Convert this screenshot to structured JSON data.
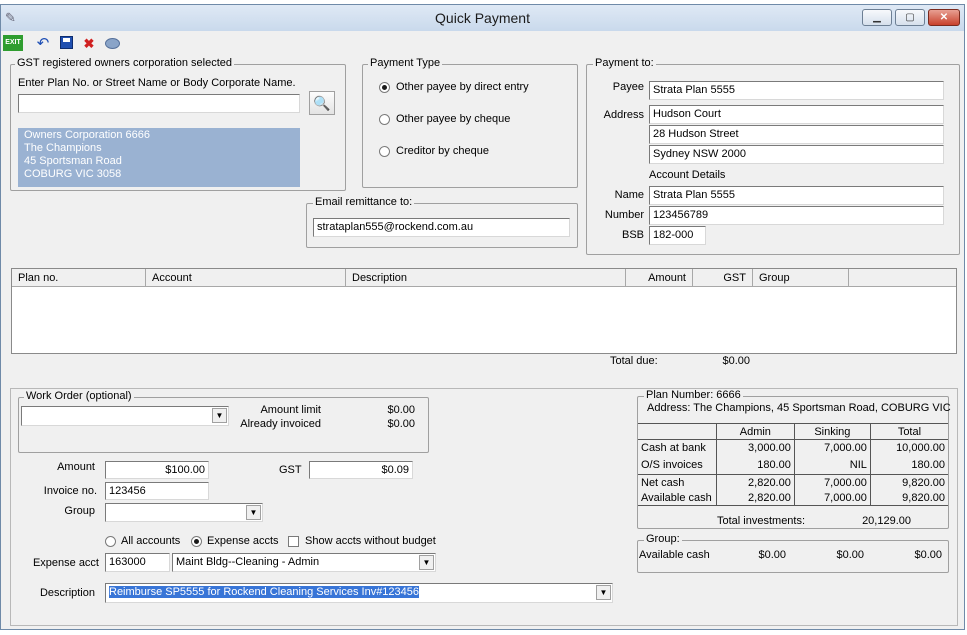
{
  "window": {
    "title": "Quick Payment"
  },
  "toolbar": {
    "buttons": [
      "exit-icon",
      "undo-icon",
      "save-icon",
      "delete-icon",
      "database-icon"
    ],
    "exit_label": "EXIT"
  },
  "gst_group": {
    "legend": "GST registered owners corporation selected",
    "prompt": "Enter Plan No. or Street Name or Body Corporate Name.",
    "search_value": "",
    "selected": [
      "Owners Corporation 6666",
      "The Champions",
      "45 Sportsman Road",
      "COBURG  VIC  3058"
    ]
  },
  "payment_type": {
    "legend": "Payment Type",
    "options": [
      "Other payee by direct entry",
      "Other payee by cheque",
      "Creditor by cheque"
    ],
    "selected_index": 0
  },
  "email": {
    "legend": "Email remittance to:",
    "value": "strataplan555@rockend.com.au"
  },
  "payment_to": {
    "legend": "Payment to:",
    "payee_label": "Payee",
    "payee": "Strata Plan 5555",
    "address_label": "Address",
    "address": [
      "Hudson Court",
      "28 Hudson Street",
      "Sydney NSW 2000"
    ],
    "account_details_label": "Account Details",
    "name_label": "Name",
    "name": "Strata Plan 5555",
    "number_label": "Number",
    "number": "123456789",
    "bsb_label": "BSB",
    "bsb": "182-000"
  },
  "grid": {
    "columns": [
      "Plan no.",
      "Account",
      "Description",
      "Amount",
      "GST",
      "Group"
    ],
    "rows": []
  },
  "total_due": {
    "label": "Total due:",
    "value": "$0.00"
  },
  "work_order": {
    "legend": "Work Order (optional)",
    "value": "",
    "amount_limit_label": "Amount limit",
    "amount_limit": "$0.00",
    "already_invoiced_label": "Already invoiced",
    "already_invoiced": "$0.00"
  },
  "form": {
    "amount_label": "Amount",
    "amount": "$100.00",
    "gst_label": "GST",
    "gst": "$0.09",
    "invoice_label": "Invoice no.",
    "invoice": "123456",
    "group_label": "Group",
    "group": "",
    "account_filters": [
      "All accounts",
      "Expense accts"
    ],
    "account_filter_selected": 1,
    "show_without_budget_label": "Show accts without budget",
    "show_without_budget": false,
    "expense_acct_label": "Expense acct",
    "expense_acct_code": "163000",
    "expense_acct_name": "Maint Bldg--Cleaning - Admin",
    "description_label": "Description",
    "description": "Reimburse SP5555 for Rockend Cleaning Services Inv#123456"
  },
  "plan_info": {
    "plan_number": "Plan Number: 6666",
    "address": "Address: The Champions, 45 Sportsman Road, COBURG  VIC",
    "headers": [
      "Admin",
      "Sinking",
      "Total"
    ],
    "rows": [
      {
        "label": "Cash at bank",
        "admin": "3,000.00",
        "sinking": "7,000.00",
        "total": "10,000.00"
      },
      {
        "label": "O/S invoices",
        "admin": "180.00",
        "sinking": "NIL",
        "total": "180.00"
      },
      {
        "label": "Net cash",
        "admin": "2,820.00",
        "sinking": "7,000.00",
        "total": "9,820.00"
      },
      {
        "label": "Available cash",
        "admin": "2,820.00",
        "sinking": "7,000.00",
        "total": "9,820.00"
      }
    ],
    "investments_label": "Total investments:",
    "investments": "20,129.00"
  },
  "group_box": {
    "legend": "Group:",
    "label": "Available cash",
    "admin": "$0.00",
    "sinking": "$0.00",
    "total": "$0.00"
  }
}
